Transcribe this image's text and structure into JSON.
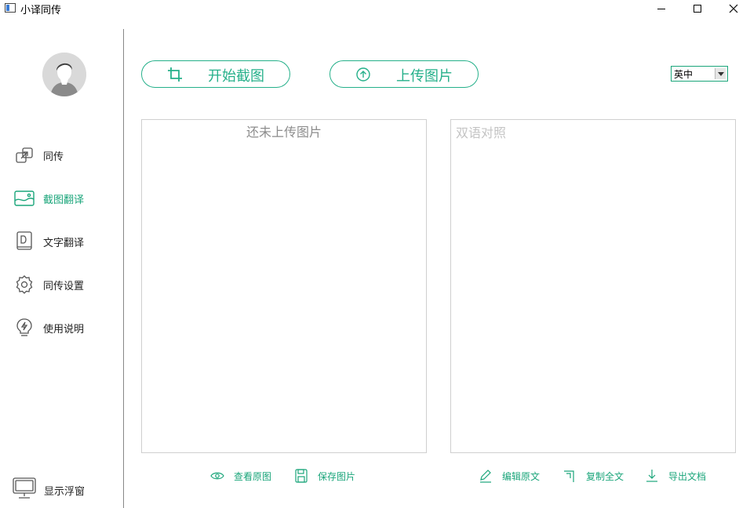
{
  "window": {
    "title": "小译同传"
  },
  "sidebar": {
    "items": [
      {
        "label": "同传",
        "icon": "link-arrow-icon",
        "active": false
      },
      {
        "label": "截图翻译",
        "icon": "image-icon",
        "active": true
      },
      {
        "label": "文字翻译",
        "icon": "document-icon",
        "active": false
      },
      {
        "label": "同传设置",
        "icon": "gear-icon",
        "active": false
      },
      {
        "label": "使用说明",
        "icon": "lightbulb-icon",
        "active": false
      }
    ],
    "float_toggle_label": "显示浮窗"
  },
  "toolbar": {
    "crop_label": "开始截图",
    "upload_label": "上传图片",
    "language_selected": "英中"
  },
  "panels": {
    "source_placeholder": "还未上传图片",
    "result_placeholder": "双语对照"
  },
  "actions": {
    "view_original": "查看原图",
    "save_image": "保存图片",
    "edit_source": "编辑原文",
    "copy_all": "复制全文",
    "export_doc": "导出文档"
  },
  "colors": {
    "accent": "#1aa57a",
    "border": "#cfcfcf"
  }
}
